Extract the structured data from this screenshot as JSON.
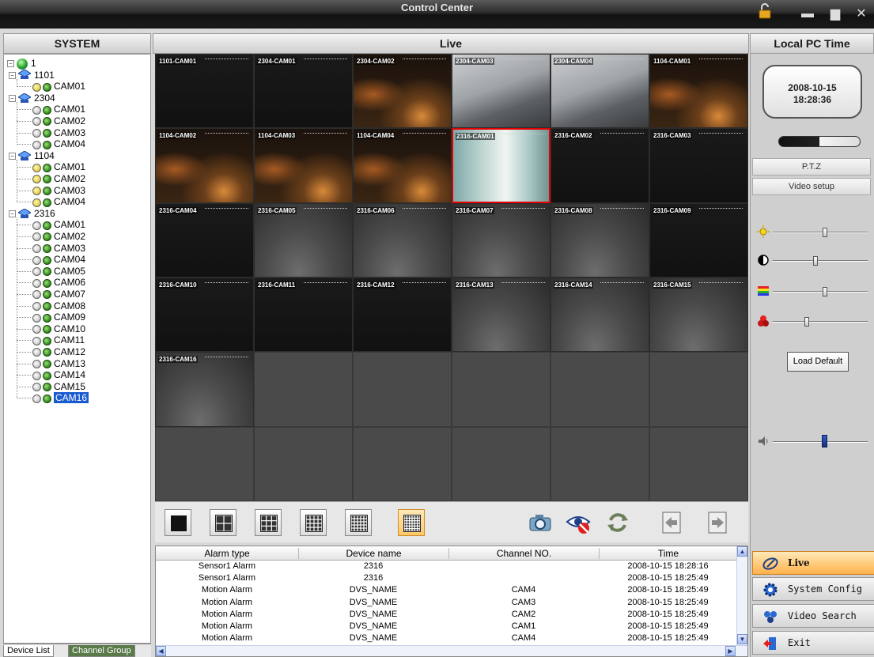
{
  "window": {
    "title": "Control Center",
    "controls": [
      "lock-icon",
      "minimize-icon",
      "maximize-icon",
      "close-icon"
    ]
  },
  "headers": {
    "system": "SYSTEM",
    "live": "Live",
    "local_time": "Local PC Time"
  },
  "tree": {
    "root": "1",
    "devices": [
      {
        "name": "1101",
        "channels": [
          {
            "name": "CAM01",
            "rec": "yellow"
          }
        ]
      },
      {
        "name": "2304",
        "channels": [
          {
            "name": "CAM01",
            "rec": "gray"
          },
          {
            "name": "CAM02",
            "rec": "gray"
          },
          {
            "name": "CAM03",
            "rec": "gray"
          },
          {
            "name": "CAM04",
            "rec": "gray"
          }
        ]
      },
      {
        "name": "1104",
        "channels": [
          {
            "name": "CAM01",
            "rec": "yellow"
          },
          {
            "name": "CAM02",
            "rec": "yellow"
          },
          {
            "name": "CAM03",
            "rec": "yellow"
          },
          {
            "name": "CAM04",
            "rec": "yellow"
          }
        ]
      },
      {
        "name": "2316",
        "channels": [
          {
            "name": "CAM01",
            "rec": "gray"
          },
          {
            "name": "CAM02",
            "rec": "gray"
          },
          {
            "name": "CAM03",
            "rec": "gray"
          },
          {
            "name": "CAM04",
            "rec": "gray"
          },
          {
            "name": "CAM05",
            "rec": "gray"
          },
          {
            "name": "CAM06",
            "rec": "gray"
          },
          {
            "name": "CAM07",
            "rec": "gray"
          },
          {
            "name": "CAM08",
            "rec": "gray"
          },
          {
            "name": "CAM09",
            "rec": "gray"
          },
          {
            "name": "CAM10",
            "rec": "gray"
          },
          {
            "name": "CAM11",
            "rec": "gray"
          },
          {
            "name": "CAM12",
            "rec": "gray"
          },
          {
            "name": "CAM13",
            "rec": "gray"
          },
          {
            "name": "CAM14",
            "rec": "gray"
          },
          {
            "name": "CAM15",
            "rec": "gray"
          },
          {
            "name": "CAM16",
            "rec": "gray",
            "selected": true
          }
        ]
      }
    ],
    "tabs": {
      "device_list": "Device List",
      "channel_group": "Channel Group"
    }
  },
  "live": {
    "cells": [
      {
        "label": "1101-CAM01",
        "scene": "dark"
      },
      {
        "label": "2304-CAM01",
        "scene": "dark"
      },
      {
        "label": "2304-CAM02",
        "scene": "night"
      },
      {
        "label": "2304-CAM03",
        "scene": "gray"
      },
      {
        "label": "2304-CAM04",
        "scene": "gray"
      },
      {
        "label": "1104-CAM01",
        "scene": "night"
      },
      {
        "label": "1104-CAM02",
        "scene": "night"
      },
      {
        "label": "1104-CAM03",
        "scene": "night"
      },
      {
        "label": "1104-CAM04",
        "scene": "night"
      },
      {
        "label": "2316-CAM01",
        "scene": "corridor",
        "selected": true
      },
      {
        "label": "2316-CAM02",
        "scene": "dark"
      },
      {
        "label": "2316-CAM03",
        "scene": "dark"
      },
      {
        "label": "2316-CAM04",
        "scene": "dark"
      },
      {
        "label": "2316-CAM05",
        "scene": "fog"
      },
      {
        "label": "2316-CAM06",
        "scene": "fog"
      },
      {
        "label": "2316-CAM07",
        "scene": "fog"
      },
      {
        "label": "2316-CAM08",
        "scene": "fog"
      },
      {
        "label": "2316-CAM09",
        "scene": "dark"
      },
      {
        "label": "2316-CAM10",
        "scene": "dark"
      },
      {
        "label": "2316-CAM11",
        "scene": "dark"
      },
      {
        "label": "2316-CAM12",
        "scene": "dark"
      },
      {
        "label": "2316-CAM13",
        "scene": "fog"
      },
      {
        "label": "2316-CAM14",
        "scene": "fog"
      },
      {
        "label": "2316-CAM15",
        "scene": "fog"
      },
      {
        "label": "2316-CAM16",
        "scene": "fog"
      }
    ],
    "layouts": [
      "1x1-layout-icon",
      "2x2-layout-icon",
      "3x3-layout-icon",
      "4x4-layout-icon",
      "5x5-layout-icon",
      "6x6-layout-icon"
    ],
    "active_layout": 5,
    "tools": [
      "snapshot-icon",
      "stop-view-icon",
      "refresh-icon",
      "previous-page-icon",
      "next-page-icon"
    ]
  },
  "alarm": {
    "columns": [
      "Alarm type",
      "Device name",
      "Channel NO.",
      "Time"
    ],
    "rows": [
      [
        "Sensor1 Alarm",
        "2316",
        "",
        "2008-10-15 18:28:16"
      ],
      [
        "Sensor1 Alarm",
        "2316",
        "",
        "2008-10-15 18:25:49"
      ],
      [
        "Motion Alarm",
        "DVS_NAME",
        "CAM4",
        "2008-10-15 18:25:49"
      ],
      [
        "Motion Alarm",
        "DVS_NAME",
        "CAM3",
        "2008-10-15 18:25:49"
      ],
      [
        "Motion Alarm",
        "DVS_NAME",
        "CAM2",
        "2008-10-15 18:25:49"
      ],
      [
        "Motion Alarm",
        "DVS_NAME",
        "CAM1",
        "2008-10-15 18:25:49"
      ],
      [
        "Motion Alarm",
        "DVS_NAME",
        "CAM4",
        "2008-10-15 18:25:49"
      ]
    ]
  },
  "right": {
    "date": "2008-10-15",
    "time": "18:28:36",
    "ptz": "P.T.Z",
    "video_setup": "Video setup",
    "sliders": [
      {
        "icon": "brightness-icon",
        "level": 0.55
      },
      {
        "icon": "contrast-icon",
        "level": 0.45
      },
      {
        "icon": "saturation-icon",
        "level": 0.55
      },
      {
        "icon": "hue-icon",
        "level": 0.35
      }
    ],
    "load_default": "Load Default",
    "volume_level": 0.55,
    "nav": [
      {
        "label": "Live",
        "icon": "live-icon",
        "active": true
      },
      {
        "label": "System Config",
        "icon": "gear-icon",
        "active": false
      },
      {
        "label": "Video Search",
        "icon": "video-search-icon",
        "active": false
      },
      {
        "label": "Exit",
        "icon": "exit-icon",
        "active": false
      }
    ]
  }
}
